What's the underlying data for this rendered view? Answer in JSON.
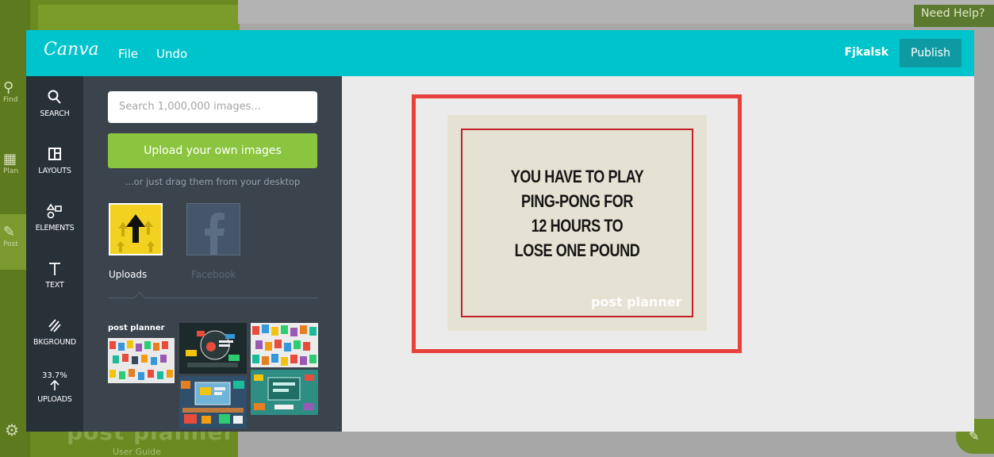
{
  "background_app": {
    "sidebar": [
      {
        "label": "Find",
        "icon": "search-icon"
      },
      {
        "label": "Plan",
        "icon": "calendar-icon"
      },
      {
        "label": "Post",
        "icon": "pencil-icon"
      }
    ],
    "brand": "post planner",
    "user_guide": "User Guide",
    "need_help": "Need Help?"
  },
  "header": {
    "logo": "Canva",
    "menu": [
      "File",
      "Undo"
    ],
    "username": "Fjkalsk",
    "publish_label": "Publish"
  },
  "nav": {
    "items": [
      {
        "label": "SEARCH",
        "icon": "search-icon"
      },
      {
        "label": "LAYOUTS",
        "icon": "layout-icon"
      },
      {
        "label": "ELEMENTS",
        "icon": "shapes-icon"
      },
      {
        "label": "TEXT",
        "icon": "text-icon"
      },
      {
        "label": "BKGROUND",
        "icon": "background-icon"
      },
      {
        "label": "UPLOADS",
        "icon": "upload-icon"
      }
    ],
    "upload_progress": "33.7%"
  },
  "panel": {
    "search_placeholder": "Search 1,000,000 images...",
    "upload_button": "Upload your own images",
    "drag_hint": "...or just drag them from your desktop",
    "sources": [
      {
        "label": "Uploads",
        "active": true
      },
      {
        "label": "Facebook",
        "active": false
      }
    ],
    "thumb_brand": "post planner"
  },
  "design": {
    "quote_lines": [
      "YOU HAVE TO PLAY",
      "PING-PONG FOR",
      "12 HOURS TO",
      "LOSE ONE POUND"
    ],
    "watermark": "post planner"
  },
  "colors": {
    "topbar": "#00c4cc",
    "nav": "#283038",
    "panel": "#3b434c",
    "upload_green": "#8bc53f",
    "highlight_red": "#e8403a"
  }
}
